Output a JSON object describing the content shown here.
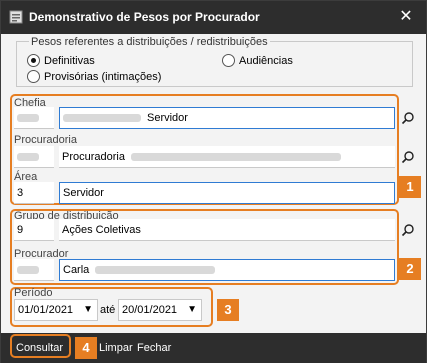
{
  "window": {
    "title": "Demonstrativo de Pesos por Procurador",
    "close_glyph": "✕"
  },
  "pesos": {
    "legend": "Pesos referentes a distribuições / redistribuições",
    "options": [
      {
        "label": "Definitivas",
        "selected": true
      },
      {
        "label": "Audiências",
        "selected": false
      },
      {
        "label": "Provisórias (intimações)",
        "selected": false
      }
    ]
  },
  "chefia": {
    "label": "Chefia",
    "value": "Servidor"
  },
  "procuradoria": {
    "label": "Procuradoria",
    "value": "Procuradoria"
  },
  "area": {
    "label": "Área",
    "code": "3",
    "value": "Servidor"
  },
  "grupo": {
    "label": "Grupo de distribuição",
    "code": "9",
    "value": "Ações Coletivas"
  },
  "procurador": {
    "label": "Procurador",
    "value": "Carla"
  },
  "periodo": {
    "label": "Período",
    "from": "01/01/2021",
    "separator": "até",
    "to": "20/01/2021"
  },
  "buttons": {
    "consultar": "Consultar",
    "limpar": "Limpar",
    "fechar": "Fechar"
  },
  "badges": [
    "1",
    "2",
    "3",
    "4"
  ],
  "colors": {
    "accent": "#e67e22",
    "titlebar": "#2d2d2d",
    "focus": "#2f7bd3"
  }
}
